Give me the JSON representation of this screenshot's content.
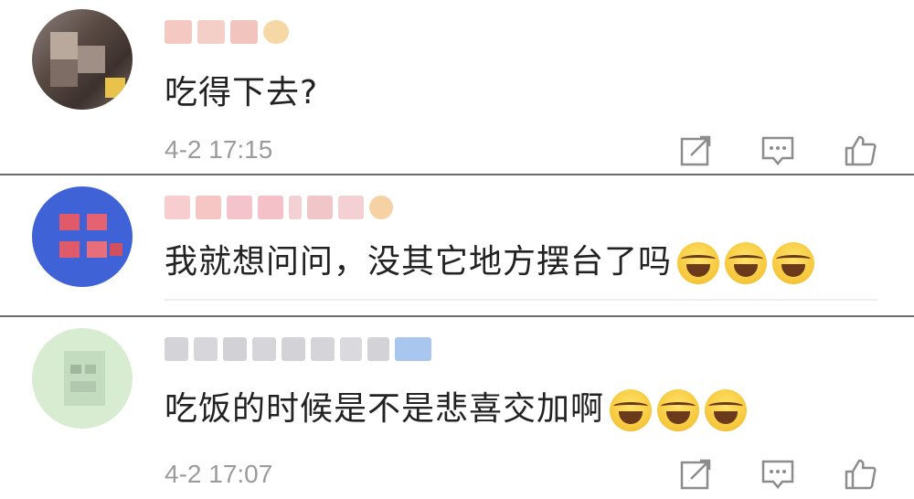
{
  "comments": [
    {
      "text": "吃得下去?",
      "time": "4-2 17:15",
      "emoji_count": 0
    },
    {
      "text": "我就想问问，没其它地方摆台了吗",
      "time": "",
      "emoji_count": 3
    },
    {
      "text": "吃饭的时候是不是悲喜交加啊",
      "time": "4-2 17:07",
      "emoji_count": 3
    }
  ],
  "icons": {
    "share": "share-icon",
    "comment": "comment-icon",
    "like": "thumbs-up-icon",
    "emoji": "laughing-tears-emoji"
  },
  "colors": {
    "text": "#222222",
    "time": "#9b9b9b",
    "divider": "#6b6b6b",
    "icon": "#8c8c8c"
  }
}
